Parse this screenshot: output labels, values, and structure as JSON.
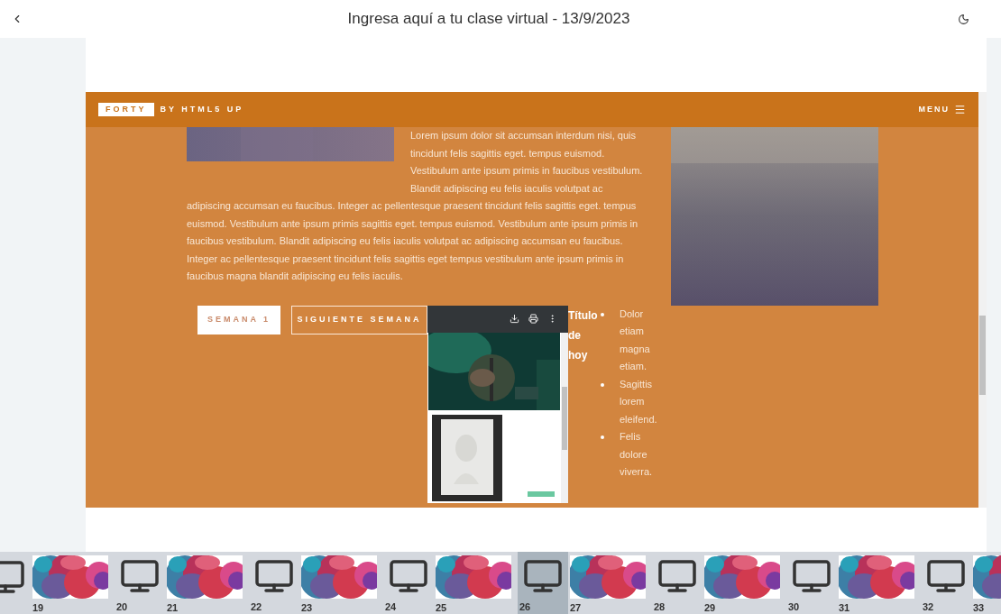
{
  "top_bar": {
    "title": "Ingresa aquí a tu clase virtual - 13/9/2023"
  },
  "slide": {
    "header": {
      "logo": "FORTY",
      "byline": "BY HTML5 UP",
      "menu": "MENU"
    },
    "paragraph_beside_image": "Lorem ipsum dolor sit accumsan interdum nisi, quis tincidunt felis sagittis eget. tempus euismod. Vestibulum ante ipsum primis in faucibus vestibulum. Blandit adipiscing eu felis iaculis volutpat ac",
    "paragraph": "adipiscing accumsan eu faucibus. Integer ac pellentesque praesent tincidunt felis sagittis eget. tempus euismod. Vestibulum ante ipsum primis sagittis eget. tempus euismod. Vestibulum ante ipsum primis in faucibus vestibulum. Blandit adipiscing eu felis iaculis volutpat ac adipiscing accumsan eu faucibus. Integer ac pellentesque praesent tincidunt felis sagittis eget tempus vestibulum ante ipsum primis in faucibus magna blandit adipiscing eu felis iaculis.",
    "buttons": [
      {
        "label": "SEMANA 1",
        "kind": "filled"
      },
      {
        "label": "SIGUIENTE SEMANA",
        "kind": "outline"
      }
    ],
    "heading": "Título de hoy",
    "list": [
      "Dolor etiam magna etiam.",
      "Sagittis lorem eleifend.",
      "Felis dolore viverra."
    ]
  },
  "filmstrip": [
    {
      "kind": "monitor",
      "selected": false
    },
    {
      "number": "19",
      "kind": "picture",
      "selected": false
    },
    {
      "number": "20",
      "kind": "monitor",
      "selected": false
    },
    {
      "number": "21",
      "kind": "picture",
      "selected": false
    },
    {
      "number": "22",
      "kind": "monitor",
      "selected": false
    },
    {
      "number": "23",
      "kind": "picture",
      "selected": false
    },
    {
      "number": "24",
      "kind": "monitor",
      "selected": false
    },
    {
      "number": "25",
      "kind": "picture",
      "selected": false
    },
    {
      "number": "26",
      "kind": "monitor",
      "selected": true
    },
    {
      "number": "27",
      "kind": "picture",
      "selected": false
    },
    {
      "number": "28",
      "kind": "monitor",
      "selected": false
    },
    {
      "number": "29",
      "kind": "picture",
      "selected": false
    },
    {
      "number": "30",
      "kind": "monitor",
      "selected": false
    },
    {
      "number": "31",
      "kind": "picture",
      "selected": false
    },
    {
      "number": "32",
      "kind": "monitor",
      "selected": false
    },
    {
      "number": "33",
      "kind": "picture",
      "selected": false
    }
  ]
}
